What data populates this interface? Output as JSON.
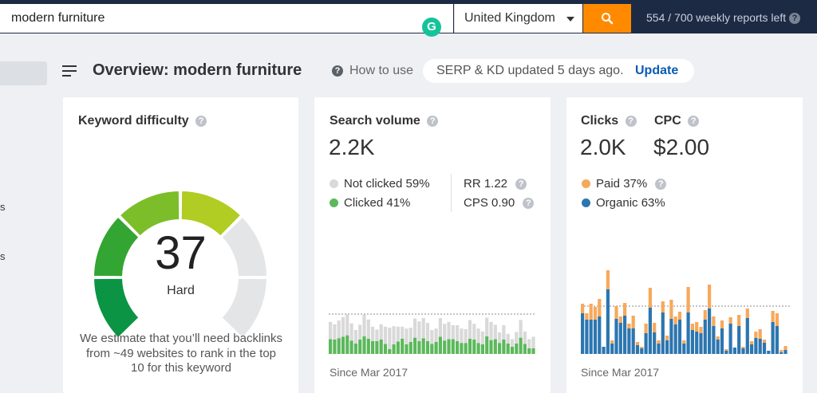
{
  "search": {
    "query": "modern furniture",
    "grammarly_glyph": "G"
  },
  "country": {
    "selected": "United Kingdom"
  },
  "search_button": {
    "icon": "search-icon"
  },
  "reports": {
    "text": "554 / 700 weekly reports left",
    "help": "?"
  },
  "sidebar": {
    "fragments": [
      "s",
      "s"
    ]
  },
  "header": {
    "title": "Overview: modern furniture",
    "help": "?",
    "how_to_use": "How to use"
  },
  "update_notice": {
    "text": "SERP & KD updated 5 days ago.",
    "link": "Update"
  },
  "keyword_difficulty": {
    "title": "Keyword difficulty",
    "help": "?",
    "score": 37,
    "score_text": "37",
    "label": "Hard",
    "description": "We estimate that you’ll need backlinks from ~49 websites to rank in the top 10 for this keyword",
    "colors": [
      "#0b9444",
      "#33a532",
      "#7cbd2a",
      "#b1cc22",
      "#e4e5e7",
      "#e4e5e7"
    ]
  },
  "search_volume": {
    "title": "Search volume",
    "help": "?",
    "value": "2.2K",
    "not_clicked": "Not clicked 59%",
    "clicked": "Clicked 41%",
    "rr": "RR 1.22",
    "cps": "CPS 0.90",
    "since": "Since Mar 2017",
    "colors": {
      "not_clicked": "#d9d9d9",
      "clicked": "#5cb85c"
    }
  },
  "clicks": {
    "title": "Clicks",
    "cpc_title": "CPC",
    "help": "?",
    "value": "2.0K",
    "cpc": "$2.00",
    "paid": "Paid 37%",
    "organic": "Organic 63%",
    "since": "Since Mar 2017",
    "colors": {
      "paid": "#f6a95b",
      "organic": "#2c76b0"
    }
  },
  "chart_data": [
    {
      "type": "bar",
      "stacked": true,
      "title": "Search volume",
      "series": [
        {
          "name": "Clicked",
          "values": [
            31,
            30,
            33,
            36,
            39,
            28,
            22,
            30,
            37,
            32,
            27,
            27,
            30,
            21,
            10,
            20,
            26,
            32,
            20,
            25,
            34,
            27,
            33,
            27,
            21,
            25,
            36,
            28,
            31,
            31,
            27,
            23,
            23,
            32,
            30,
            23,
            20,
            37,
            29,
            31,
            23,
            30,
            22,
            15,
            22,
            34,
            21,
            12,
            12
          ]
        },
        {
          "name": "Not clicked",
          "values": [
            36,
            32,
            37,
            41,
            44,
            36,
            28,
            31,
            45,
            40,
            30,
            24,
            32,
            36,
            45,
            38,
            31,
            25,
            33,
            30,
            40,
            41,
            42,
            38,
            29,
            28,
            39,
            35,
            36,
            29,
            33,
            30,
            29,
            39,
            33,
            30,
            27,
            39,
            38,
            30,
            22,
            30,
            20,
            16,
            24,
            37,
            26,
            19,
            24
          ]
        }
      ]
    },
    {
      "type": "bar",
      "stacked": true,
      "title": "Clicks",
      "series": [
        {
          "name": "Organic",
          "values": [
            51,
            43,
            43,
            43,
            47,
            9,
            81,
            13,
            44,
            39,
            48,
            32,
            32,
            11,
            7,
            26,
            58,
            27,
            13,
            52,
            17,
            44,
            37,
            43,
            13,
            52,
            30,
            28,
            26,
            43,
            57,
            35,
            18,
            32,
            4,
            38,
            8,
            35,
            7,
            45,
            12,
            20,
            19,
            14,
            4,
            40,
            35,
            2,
            5
          ]
        },
        {
          "name": "Paid",
          "values": [
            12,
            8,
            20,
            16,
            22,
            0,
            24,
            4,
            16,
            8,
            16,
            6,
            16,
            4,
            2,
            12,
            25,
            12,
            4,
            14,
            6,
            24,
            10,
            10,
            4,
            32,
            8,
            12,
            8,
            12,
            30,
            12,
            4,
            10,
            2,
            8,
            0,
            14,
            2,
            12,
            4,
            8,
            12,
            4,
            0,
            14,
            16,
            3,
            5
          ]
        }
      ]
    }
  ]
}
